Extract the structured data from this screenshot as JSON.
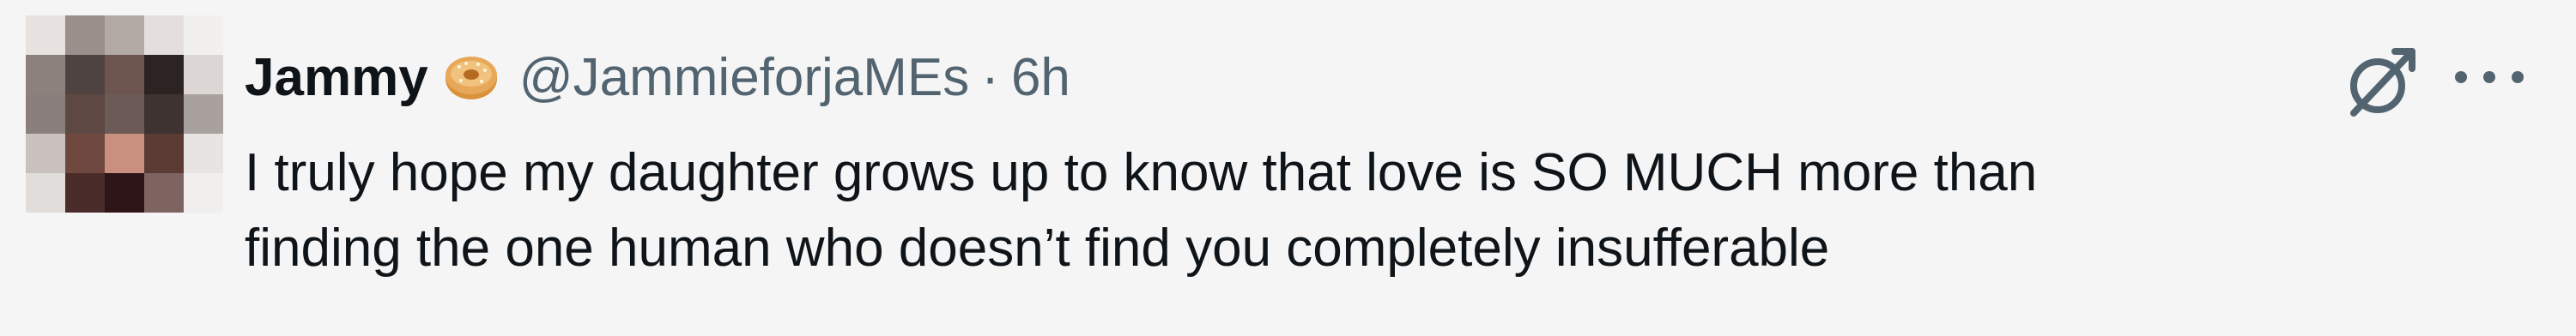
{
  "tweet": {
    "author_name": "Jammy",
    "handle": "@JammieforjaMEs",
    "separator": "·",
    "time": "6h",
    "text_line_1": "I truly hope my daughter grows up to know that love is SO MUCH more than",
    "text_line_2": "finding the one human who doesn’t find you completely insufferable"
  },
  "icons": {
    "badge": "bagel-emoji-icon",
    "grok": "grok-icon",
    "more": "more-options-icon"
  },
  "colors": {
    "background": "#f5f5f5",
    "name": "#0f1419",
    "secondary": "#536471",
    "body_text": "#0f1419"
  }
}
